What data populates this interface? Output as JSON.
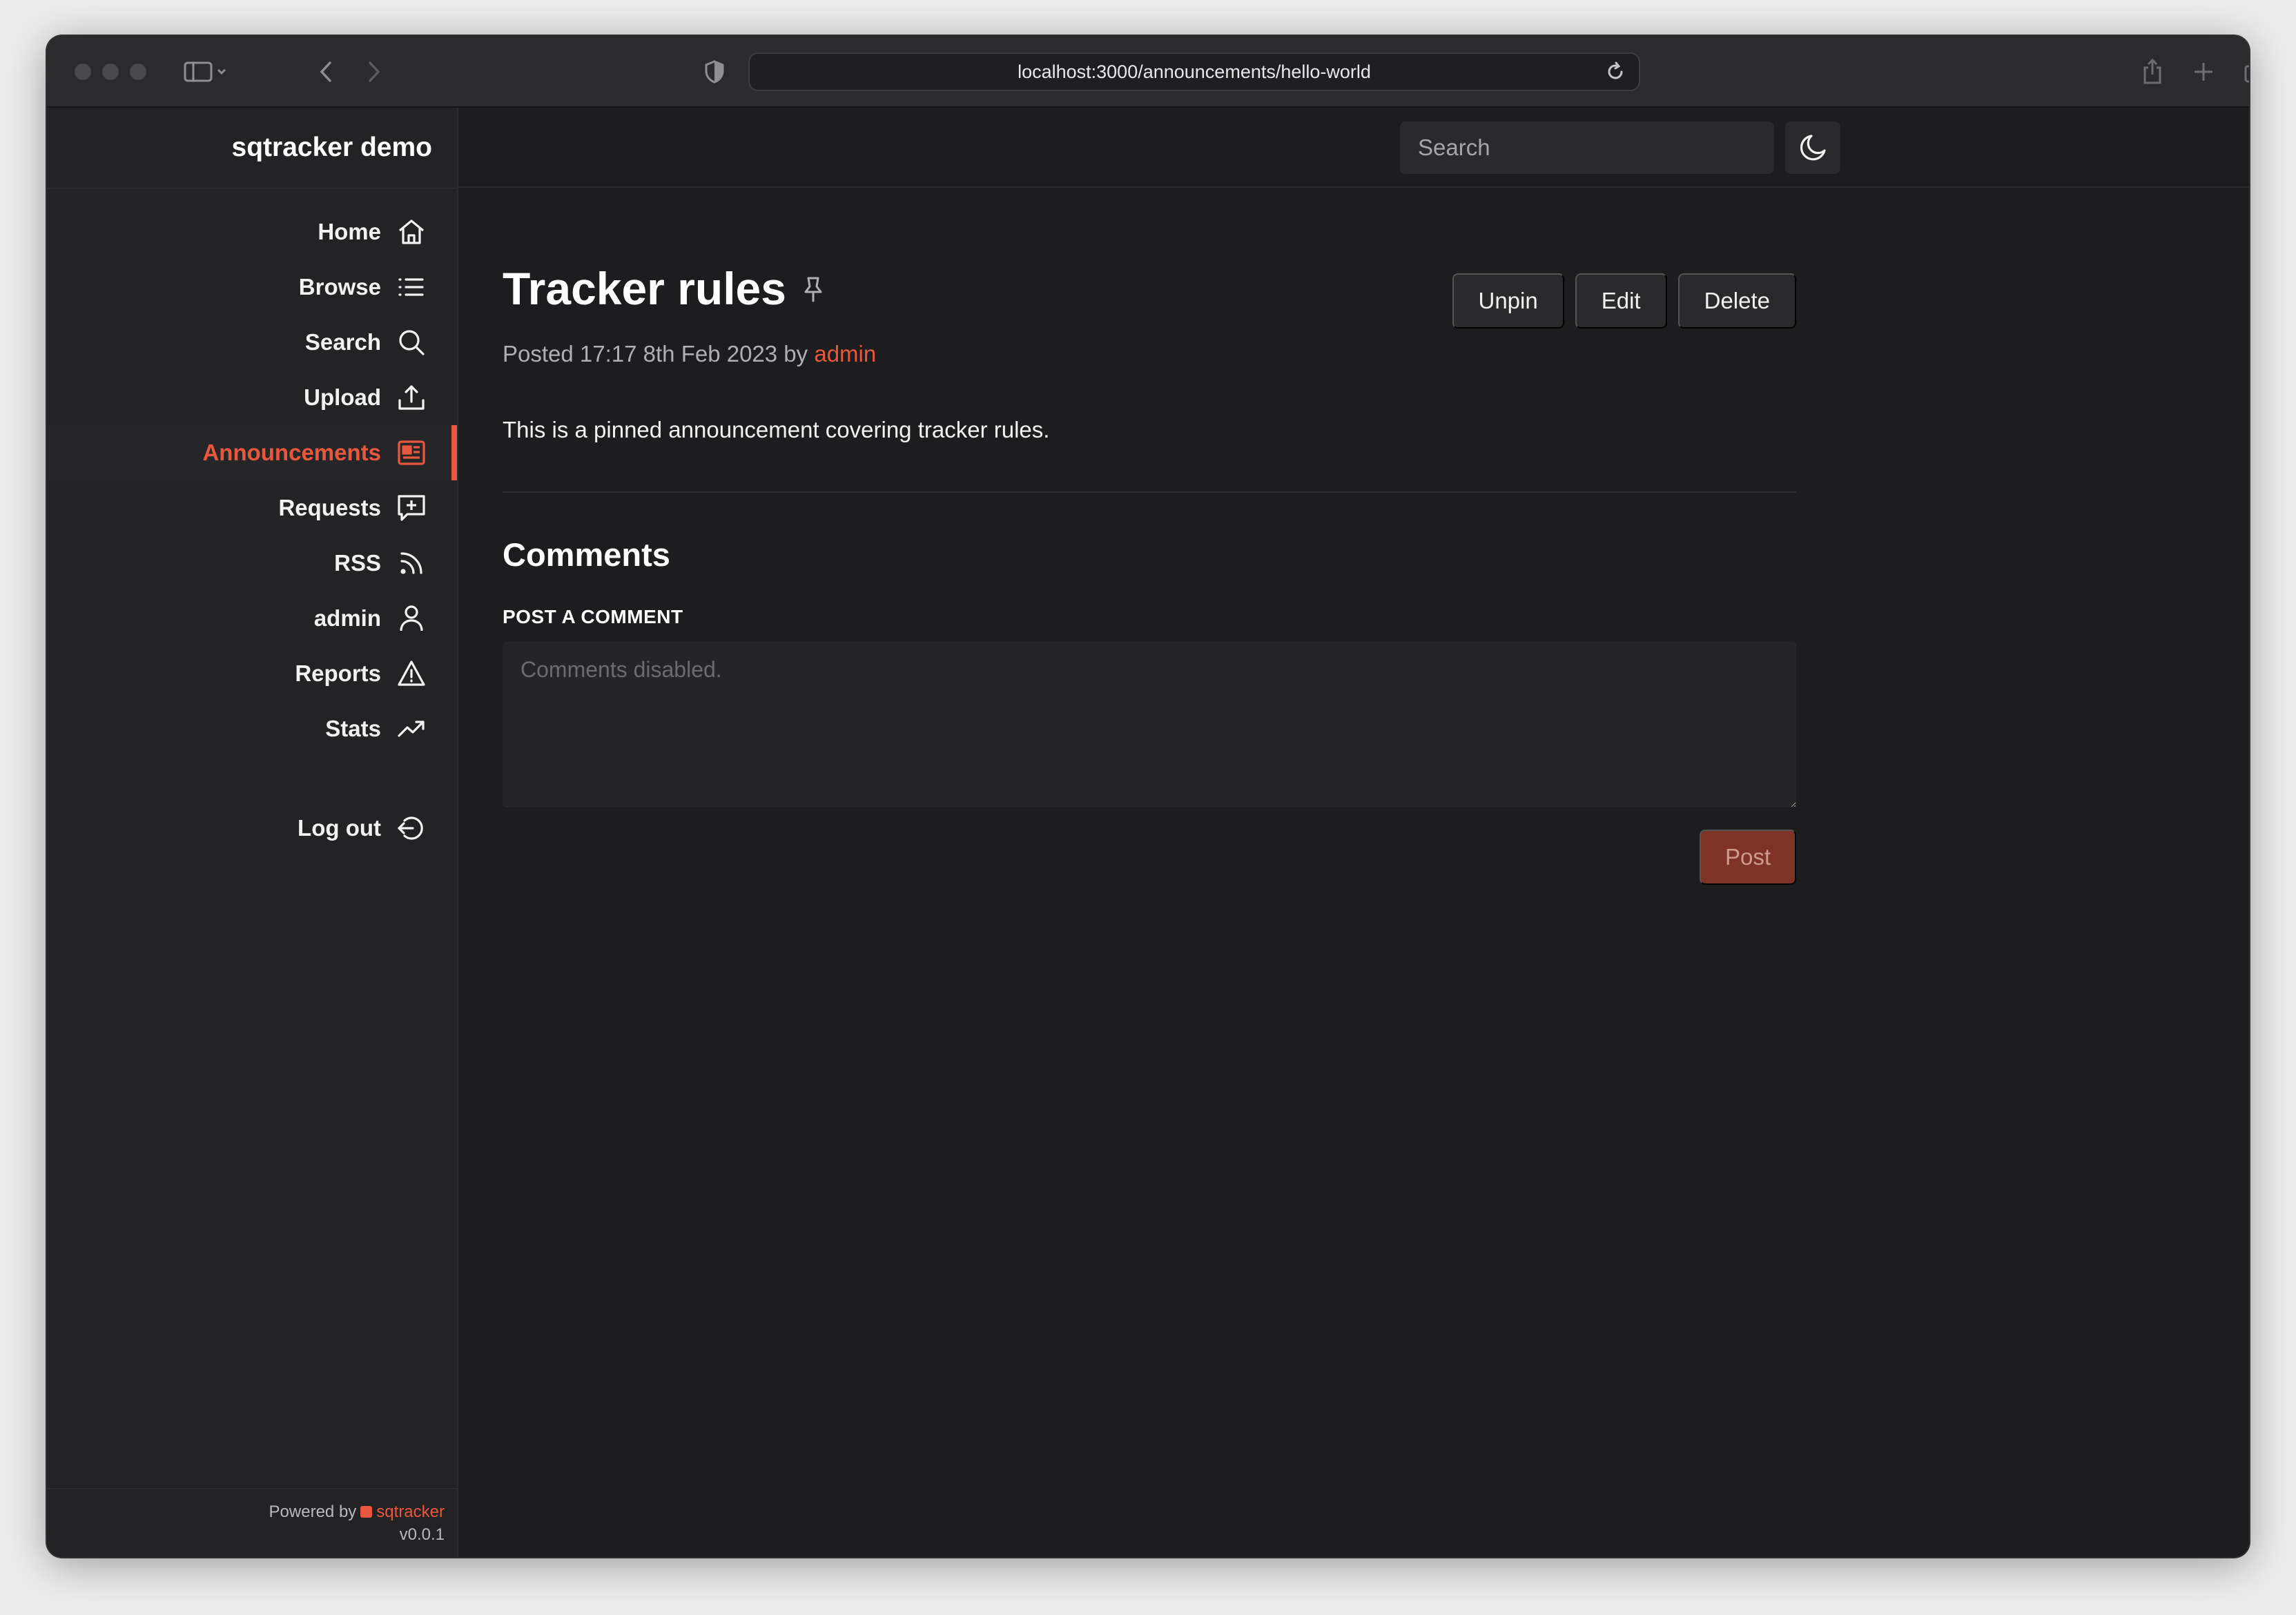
{
  "browser": {
    "url": "localhost:3000/announcements/hello-world"
  },
  "sidebar": {
    "brand": "sqtracker demo",
    "items": [
      {
        "label": "Home",
        "icon": "home-icon"
      },
      {
        "label": "Browse",
        "icon": "list-icon"
      },
      {
        "label": "Search",
        "icon": "search-icon"
      },
      {
        "label": "Upload",
        "icon": "upload-icon"
      },
      {
        "label": "Announcements",
        "icon": "newspaper-icon",
        "active": true
      },
      {
        "label": "Requests",
        "icon": "message-plus-icon"
      },
      {
        "label": "RSS",
        "icon": "rss-icon"
      },
      {
        "label": "admin",
        "icon": "user-icon"
      },
      {
        "label": "Reports",
        "icon": "warning-icon"
      },
      {
        "label": "Stats",
        "icon": "trending-up-icon"
      }
    ],
    "logout": {
      "label": "Log out",
      "icon": "logout-icon"
    },
    "footer": {
      "powered_by": "Powered by",
      "brand": "sqtracker",
      "version": "v0.0.1"
    }
  },
  "header": {
    "search_placeholder": "Search",
    "theme_icon": "moon-icon"
  },
  "announcement": {
    "title": "Tracker rules",
    "actions": {
      "unpin": "Unpin",
      "edit": "Edit",
      "delete": "Delete"
    },
    "meta_prefix": "Posted 17:17 8th Feb 2023 by",
    "author": "admin",
    "body": "This is a pinned announcement covering tracker rules."
  },
  "comments": {
    "title": "Comments",
    "post_label": "POST A COMMENT",
    "placeholder": "Comments disabled.",
    "post_button": "Post"
  },
  "colors": {
    "accent": "#e8583e",
    "background": "#1d1d1f",
    "sidebar": "#232325"
  }
}
